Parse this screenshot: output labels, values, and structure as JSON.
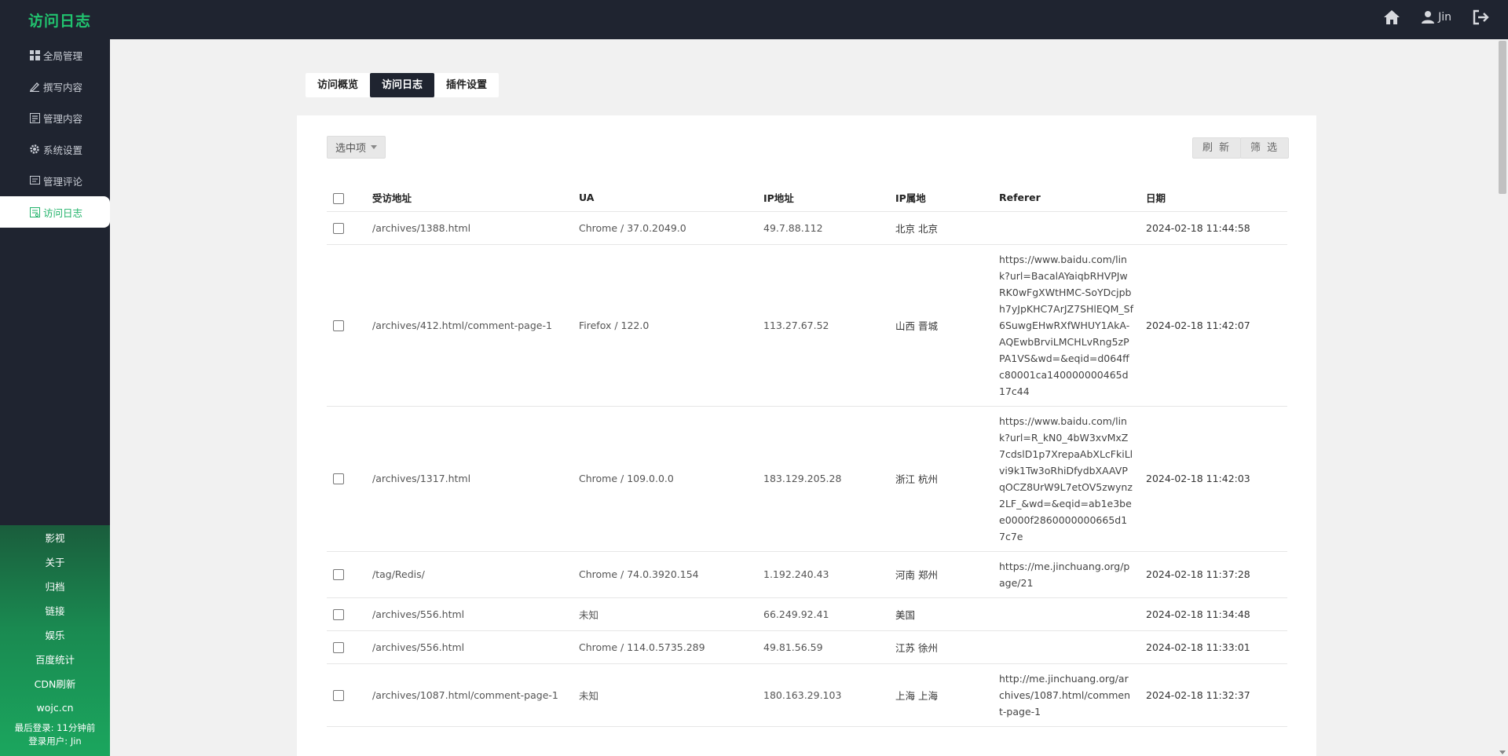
{
  "app": {
    "title": "访问日志",
    "user": "Jin"
  },
  "sidebar": {
    "items": [
      {
        "label": "全局管理",
        "icon": "dashboard-icon"
      },
      {
        "label": "撰写内容",
        "icon": "pen-icon"
      },
      {
        "label": "管理内容",
        "icon": "content-list-icon"
      },
      {
        "label": "系统设置",
        "icon": "gear-icon"
      },
      {
        "label": "管理评论",
        "icon": "comment-icon"
      },
      {
        "label": "访问日志",
        "icon": "log-icon",
        "active": true
      }
    ],
    "quick_links": [
      "影视",
      "关于",
      "归档",
      "链接",
      "娱乐",
      "百度统计",
      "CDN刷新",
      "wojc.cn"
    ],
    "last_login": "最后登录: 11分钟前",
    "login_user": "登录用户: Jin"
  },
  "tabs": [
    "访问概览",
    "访问日志",
    "插件设置"
  ],
  "toolbar": {
    "select_label": "选中项",
    "refresh_label": "刷 新",
    "filter_label": "筛 选"
  },
  "table": {
    "headers": [
      "受访地址",
      "UA",
      "IP地址",
      "IP属地",
      "Referer",
      "日期"
    ],
    "rows": [
      {
        "url": "/archives/1388.html",
        "ua": "Chrome / 37.0.2049.0",
        "ip": "49.7.88.112",
        "loc": "北京 北京",
        "referer": "",
        "date": "2024-02-18 11:44:58"
      },
      {
        "url": "/archives/412.html/comment-page-1",
        "ua": "Firefox / 122.0",
        "ip": "113.27.67.52",
        "loc": "山西 晋城",
        "referer": "https://www.baidu.com/link?url=BacalAYaiqbRHVPJwRK0wFgXWtHMC-SoYDcjpbh7yJpKHC7ArJZ7SHlEQM_Sf6SuwgEHwRXfWHUY1AkA-AQEwbBrviLMCHLvRng5zPPA1VS&wd=&eqid=d064ffc80001ca140000000465d17c44",
        "date": "2024-02-18 11:42:07"
      },
      {
        "url": "/archives/1317.html",
        "ua": "Chrome / 109.0.0.0",
        "ip": "183.129.205.28",
        "loc": "浙江 杭州",
        "referer": "https://www.baidu.com/link?url=R_kN0_4bW3xvMxZ7cdslD1p7XrepaAbXLcFkiLlvi9k1Tw3oRhiDfydbXAAVPqOCZ8UrW9L7etOV5zwynz2LF_&wd=&eqid=ab1e3bee0000f2860000000665d17c7e",
        "date": "2024-02-18 11:42:03"
      },
      {
        "url": "/tag/Redis/",
        "ua": "Chrome / 74.0.3920.154",
        "ip": "1.192.240.43",
        "loc": "河南 郑州",
        "referer": "https://me.jinchuang.org/page/21",
        "date": "2024-02-18 11:37:28"
      },
      {
        "url": "/archives/556.html",
        "ua": "未知",
        "ip": "66.249.92.41",
        "loc": "美国",
        "referer": "",
        "date": "2024-02-18 11:34:48"
      },
      {
        "url": "/archives/556.html",
        "ua": "Chrome / 114.0.5735.289",
        "ip": "49.81.56.59",
        "loc": "江苏 徐州",
        "referer": "",
        "date": "2024-02-18 11:33:01"
      },
      {
        "url": "/archives/1087.html/comment-page-1",
        "ua": "未知",
        "ip": "180.163.29.103",
        "loc": "上海 上海",
        "referer": "http://me.jinchuang.org/archives/1087.html/comment-page-1",
        "date": "2024-02-18 11:32:37"
      }
    ]
  }
}
